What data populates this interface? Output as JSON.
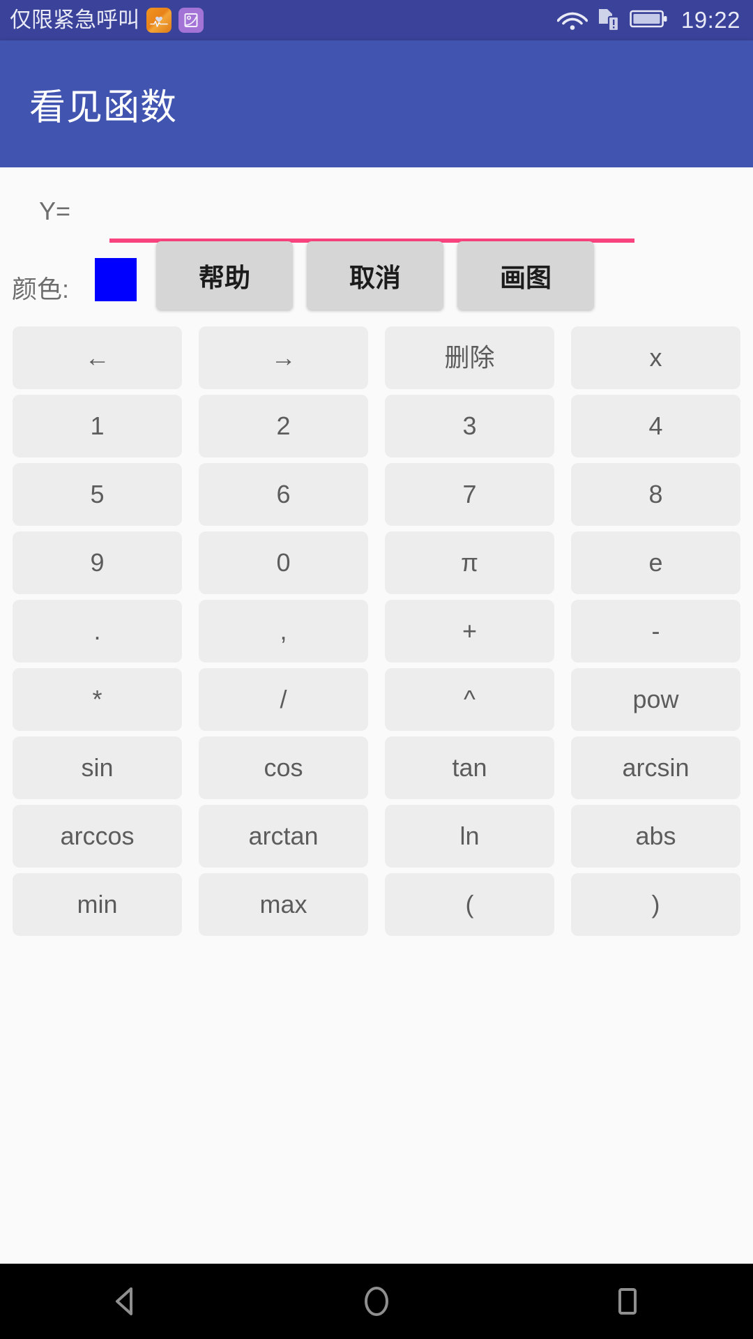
{
  "statusbar": {
    "carrier": "仅限紧急呼叫",
    "clock": "19:22",
    "notification_icons": [
      "heart-rate-app-icon",
      "photo-gallery-app-icon"
    ],
    "system_icons": [
      "wifi-icon",
      "no-sim-card-icon",
      "battery-icon"
    ],
    "background_color": "#3a4299",
    "text_color": "#e9eaf6"
  },
  "appbar": {
    "title": "看见函数",
    "background_color": "#4154b0",
    "text_color": "#ffffff"
  },
  "formula": {
    "label": "Y=",
    "value": "",
    "placeholder": "",
    "underline_color": "#f9437e"
  },
  "color_row": {
    "label": "颜色:",
    "swatch_color": "#0000ff",
    "buttons": [
      {
        "label": "帮助",
        "name": "help-button"
      },
      {
        "label": "取消",
        "name": "cancel-button"
      },
      {
        "label": "画图",
        "name": "draw-button"
      }
    ]
  },
  "keypad": {
    "rows": [
      [
        {
          "label": "←",
          "name": "key-arrow-left"
        },
        {
          "label": "→",
          "name": "key-arrow-right"
        },
        {
          "label": "删除",
          "name": "key-delete"
        },
        {
          "label": "x",
          "name": "key-x"
        }
      ],
      [
        {
          "label": "1",
          "name": "key-1"
        },
        {
          "label": "2",
          "name": "key-2"
        },
        {
          "label": "3",
          "name": "key-3"
        },
        {
          "label": "4",
          "name": "key-4"
        }
      ],
      [
        {
          "label": "5",
          "name": "key-5"
        },
        {
          "label": "6",
          "name": "key-6"
        },
        {
          "label": "7",
          "name": "key-7"
        },
        {
          "label": "8",
          "name": "key-8"
        }
      ],
      [
        {
          "label": "9",
          "name": "key-9"
        },
        {
          "label": "0",
          "name": "key-0"
        },
        {
          "label": "π",
          "name": "key-pi"
        },
        {
          "label": "e",
          "name": "key-e"
        }
      ],
      [
        {
          "label": ".",
          "name": "key-dot"
        },
        {
          "label": ",",
          "name": "key-comma"
        },
        {
          "label": "+",
          "name": "key-plus"
        },
        {
          "label": "-",
          "name": "key-minus"
        }
      ],
      [
        {
          "label": "*",
          "name": "key-multiply"
        },
        {
          "label": "/",
          "name": "key-divide"
        },
        {
          "label": "^",
          "name": "key-caret"
        },
        {
          "label": "pow",
          "name": "key-pow"
        }
      ],
      [
        {
          "label": "sin",
          "name": "key-sin"
        },
        {
          "label": "cos",
          "name": "key-cos"
        },
        {
          "label": "tan",
          "name": "key-tan"
        },
        {
          "label": "arcsin",
          "name": "key-arcsin"
        }
      ],
      [
        {
          "label": "arccos",
          "name": "key-arccos"
        },
        {
          "label": "arctan",
          "name": "key-arctan"
        },
        {
          "label": "ln",
          "name": "key-ln"
        },
        {
          "label": "abs",
          "name": "key-abs"
        }
      ],
      [
        {
          "label": "min",
          "name": "key-min"
        },
        {
          "label": "max",
          "name": "key-max"
        },
        {
          "label": "(",
          "name": "key-paren-open"
        },
        {
          "label": ")",
          "name": "key-paren-close"
        }
      ]
    ]
  },
  "navbar": {
    "buttons": [
      "back-icon",
      "home-icon",
      "recents-icon"
    ],
    "background_color": "#000000",
    "icon_color": "#8f8f8f"
  }
}
